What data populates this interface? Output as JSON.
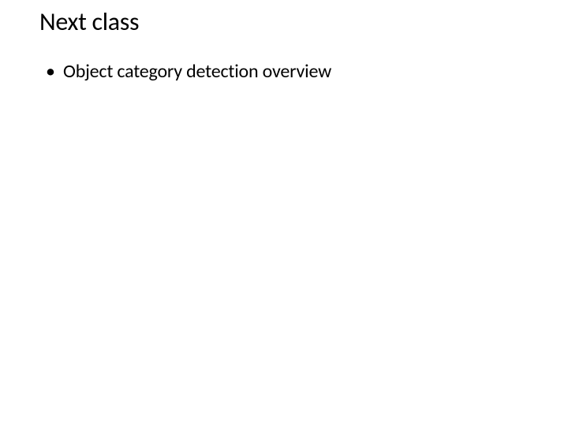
{
  "slide": {
    "title": "Next class",
    "bullets": [
      "Object category detection overview"
    ]
  }
}
